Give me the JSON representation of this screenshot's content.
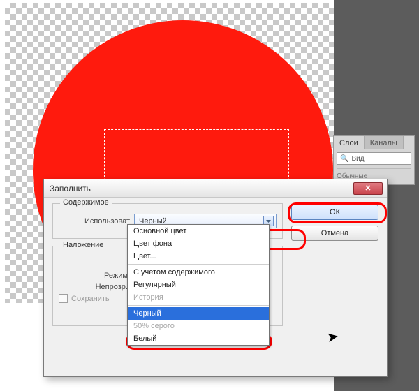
{
  "layers_panel": {
    "tabs": [
      {
        "label": "Слои",
        "active": true
      },
      {
        "label": "Каналы",
        "active": false
      }
    ],
    "search_placeholder": "Вид",
    "blend_mode": "Обычные"
  },
  "dialog": {
    "title": "Заполнить",
    "buttons": {
      "ok": "ОК",
      "cancel": "Отмена"
    },
    "groups": {
      "content": {
        "legend": "Содержимое",
        "use_label": "Использоват",
        "use_value": "Черный"
      },
      "blending": {
        "legend": "Наложение",
        "mode_label": "Режим:",
        "opacity_label": "Непрозр.:",
        "preserve_label": "Сохранить"
      }
    },
    "dropdown_items": [
      {
        "label": "Основной цвет",
        "selected": false,
        "disabled": false
      },
      {
        "label": "Цвет фона",
        "selected": false,
        "disabled": false
      },
      {
        "label": "Цвет...",
        "selected": false,
        "disabled": false
      },
      {
        "sep": true
      },
      {
        "label": "С учетом содержимого",
        "selected": false,
        "disabled": false
      },
      {
        "label": "Регулярный",
        "selected": false,
        "disabled": false
      },
      {
        "label": "История",
        "selected": false,
        "disabled": true
      },
      {
        "sep": true
      },
      {
        "label": "Черный",
        "selected": true,
        "disabled": false
      },
      {
        "label": "50% серого",
        "selected": false,
        "disabled": true
      },
      {
        "label": "Белый",
        "selected": false,
        "disabled": false
      }
    ]
  },
  "colors": {
    "shape_fill": "#ff1a0d",
    "highlight": "#ff0000",
    "selected_row": "#2a6fdc"
  }
}
